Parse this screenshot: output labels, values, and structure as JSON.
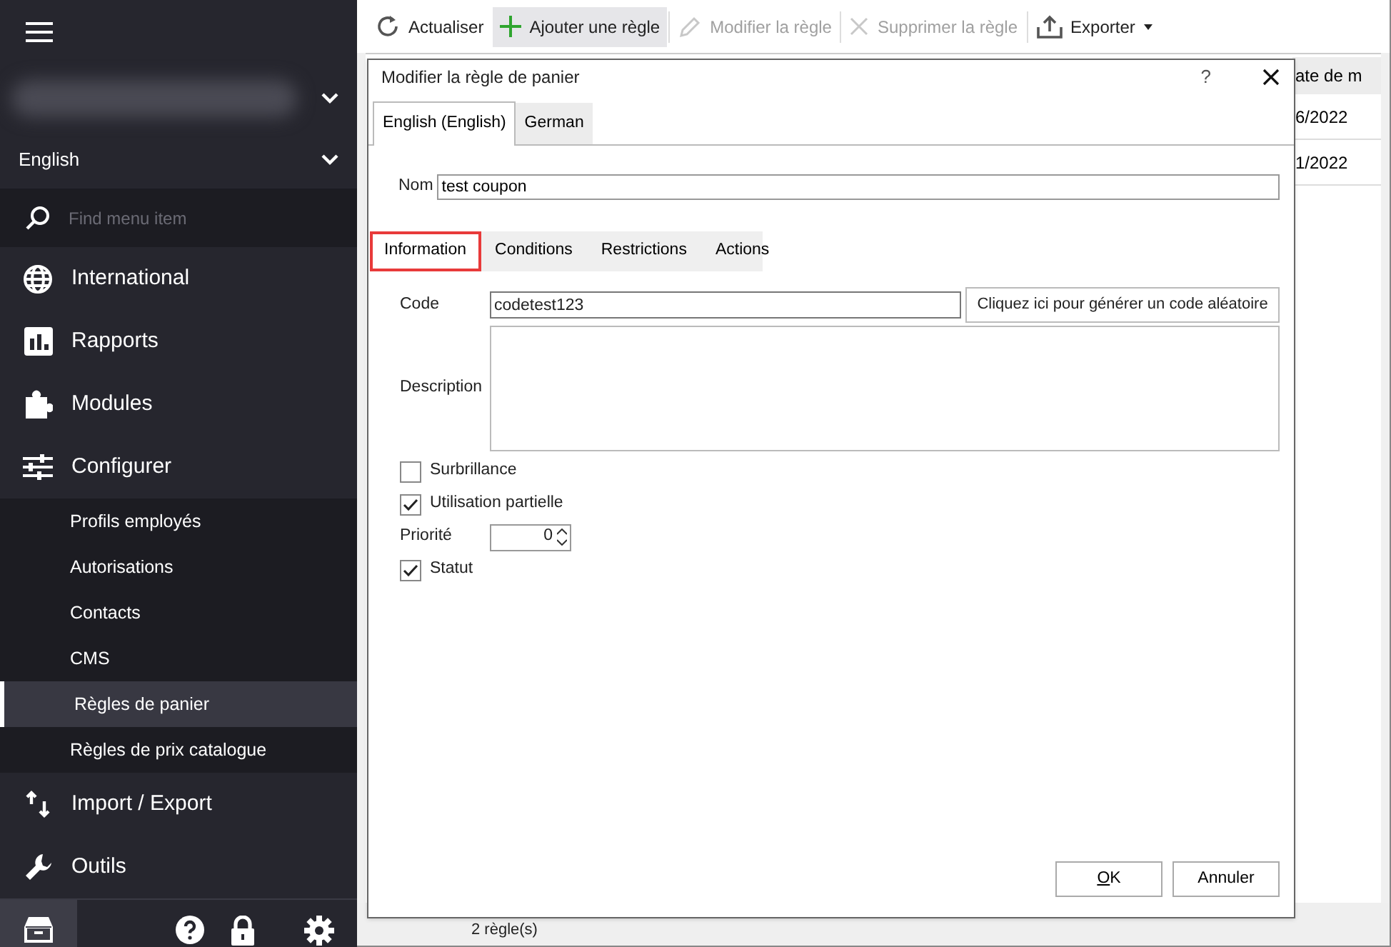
{
  "sidebar": {
    "language": "English",
    "search": {
      "placeholder": "Find menu item"
    },
    "items": [
      {
        "label": "International"
      },
      {
        "label": "Rapports"
      },
      {
        "label": "Modules"
      },
      {
        "label": "Configurer",
        "children": [
          {
            "label": "Profils employés",
            "selected": false
          },
          {
            "label": "Autorisations",
            "selected": false
          },
          {
            "label": "Contacts",
            "selected": false
          },
          {
            "label": "CMS",
            "selected": false
          },
          {
            "label": "Règles de panier",
            "selected": true
          },
          {
            "label": "Règles de prix catalogue",
            "selected": false
          }
        ]
      },
      {
        "label": "Import / Export"
      },
      {
        "label": "Outils"
      }
    ],
    "footer_buttons": [
      {
        "selected": true
      },
      {
        "selected": false
      },
      {
        "selected": false
      },
      {
        "selected": false
      }
    ]
  },
  "toolbar": [
    {
      "label": "Actualiser",
      "disabled": false,
      "highlighted": false
    },
    {
      "label": "Ajouter une règle",
      "disabled": false,
      "highlighted": true
    },
    {
      "label": "Modifier la règle",
      "disabled": true,
      "highlighted": false
    },
    {
      "label": "Supprimer la règle",
      "disabled": true,
      "highlighted": false
    },
    {
      "label": "Exporter",
      "disabled": false,
      "highlighted": false
    }
  ],
  "table": {
    "column_header": "ate de m",
    "rows": [
      "6/2022",
      "1/2022"
    ]
  },
  "status_bar": "2 règle(s)",
  "dialog": {
    "title": "Modifier la règle de panier",
    "help": "?",
    "language_tabs": [
      {
        "label": "English (English)",
        "selected": true
      },
      {
        "label": "German",
        "selected": false
      }
    ],
    "name": {
      "label": "Nom",
      "value": "test coupon"
    },
    "section_tabs": [
      {
        "label": "Information",
        "selected": true,
        "highlighted": true
      },
      {
        "label": "Conditions",
        "selected": false,
        "highlighted": false
      },
      {
        "label": "Restrictions",
        "selected": false,
        "highlighted": false
      },
      {
        "label": "Actions",
        "selected": false,
        "highlighted": false
      }
    ],
    "code": {
      "label": "Code",
      "value": "codetest123",
      "button": "Cliquez ici pour générer un code aléatoire"
    },
    "description": {
      "label": "Description"
    },
    "options": [
      {
        "kind": "checkbox",
        "label": "Surbrillance",
        "checked": false
      },
      {
        "kind": "checkbox",
        "label": "Utilisation partielle",
        "checked": true
      },
      {
        "kind": "number",
        "label": "Priorité",
        "value": "0"
      },
      {
        "kind": "checkbox",
        "label": "Statut",
        "checked": true
      }
    ],
    "buttons": [
      {
        "label": "OK",
        "underline_first": true
      },
      {
        "label": "Annuler",
        "underline_first": false
      }
    ]
  }
}
